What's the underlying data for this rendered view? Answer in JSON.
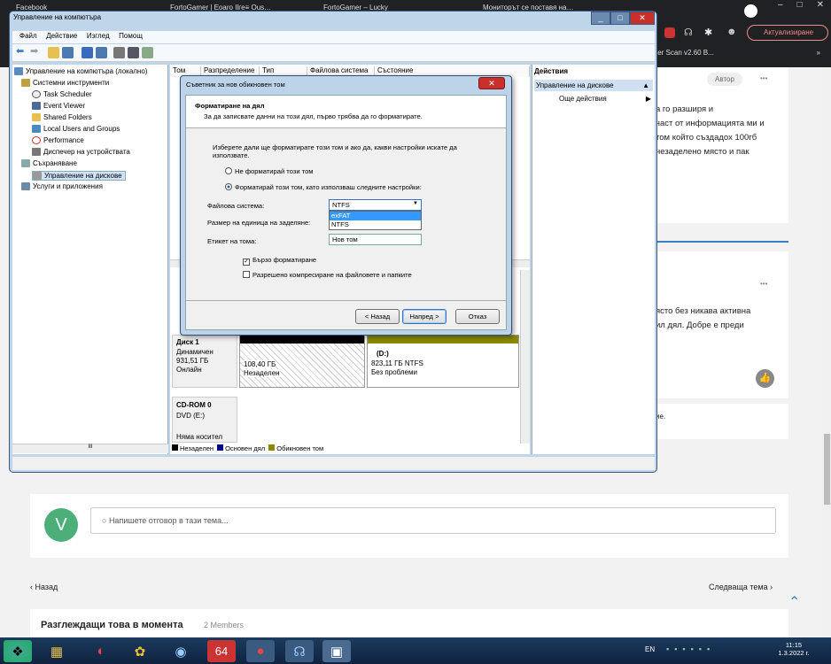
{
  "browser": {
    "tabs": [
      "Facebook",
      "FortoGamer | Eoaro Ilгe≡ Ous…",
      "FortoGamer – Lucky",
      "Мониторът се поставя на…"
    ],
    "update_button": "Актуализиране",
    "bookmark": "ter Scan v2.60 B..."
  },
  "forum": {
    "author_badge": "Автор",
    "post_lines": [
      "а го разширя и",
      "част от информацията ми и",
      "том който създадох 100гб",
      "незаделено място и пак"
    ],
    "post2_lines": [
      "ясто без никава активна",
      "ил дял. Добре е преди"
    ],
    "comment_snippet": "ие.",
    "reply_avatar": "V",
    "reply_placeholder": "Напишете отговор в тази тема...",
    "prev": "Назад",
    "next": "Следваща тема",
    "viewing_title": "Разглеждащи това в момента",
    "viewing_count": "2 Members",
    "more": "•••"
  },
  "taskbar": {
    "lang": "EN",
    "time": "11:15",
    "date": "1.3.2022 г."
  },
  "cm": {
    "title": "Управление на компютъра",
    "menu": [
      "Файл",
      "Действие",
      "Изглед",
      "Помощ"
    ],
    "tree": [
      {
        "label": "Управление на компютъра (локално)",
        "level": 0
      },
      {
        "label": "Системни инструменти",
        "level": 1
      },
      {
        "label": "Task Scheduler",
        "level": 2
      },
      {
        "label": "Event Viewer",
        "level": 2
      },
      {
        "label": "Shared Folders",
        "level": 2
      },
      {
        "label": "Local Users and Groups",
        "level": 2
      },
      {
        "label": "Performance",
        "level": 2
      },
      {
        "label": "Диспечер на устройствата",
        "level": 2
      },
      {
        "label": "Съхраняване",
        "level": 1
      },
      {
        "label": "Управление на дискове",
        "level": 2
      },
      {
        "label": "Услуги и приложения",
        "level": 1
      }
    ],
    "columns": [
      "Том",
      "Разпределение",
      "Тип",
      "Файлова система",
      "Състояние"
    ],
    "actions_title": "Действия",
    "actions_section": "Управление на дискове",
    "actions_more": "Още действия",
    "disk1": {
      "name": "Диск 1",
      "type": "Динамичен",
      "size": "931,51 ГБ",
      "status": "Онлайн"
    },
    "unalloc": {
      "size": "108,40 ГБ",
      "label": "Незаделен"
    },
    "dvol": {
      "name": "(D:)",
      "size": "823,11 ГБ NTFS",
      "status": "Без проблеми"
    },
    "cdrom": {
      "name": "CD-ROM 0",
      "drive": "DVD (E:)",
      "status": "Няма носител"
    },
    "legend": [
      "Незаделен",
      "Основен дял",
      "Обикновен том"
    ],
    "hscroll_mark": "III"
  },
  "wizard": {
    "title": "Съветник за нов обикновен том",
    "header_title": "Форматиране на дял",
    "header_sub": "За да записвате данни на този дял, първо трябва да го форматирате.",
    "intro": "Изберете дали ще форматирате този том и ако да, какви настройки искате да използвате.",
    "opt_no": "Не форматирай този том",
    "opt_yes": "Форматирай този том, като използваш следните настройки:",
    "fs_label": "Файлова система:",
    "fs_value": "NTFS",
    "fs_options": [
      "exFAT",
      "NTFS"
    ],
    "unit_label": "Размер на единица на заделяне:",
    "vol_label": "Етикет на тома:",
    "vol_value": "Нов том",
    "quick": "Бързо форматиране",
    "compress": "Разрешено компресиране на файловете и папките",
    "back": "< Назад",
    "next": "Напред >",
    "cancel": "Отказ",
    "close": "✕"
  }
}
